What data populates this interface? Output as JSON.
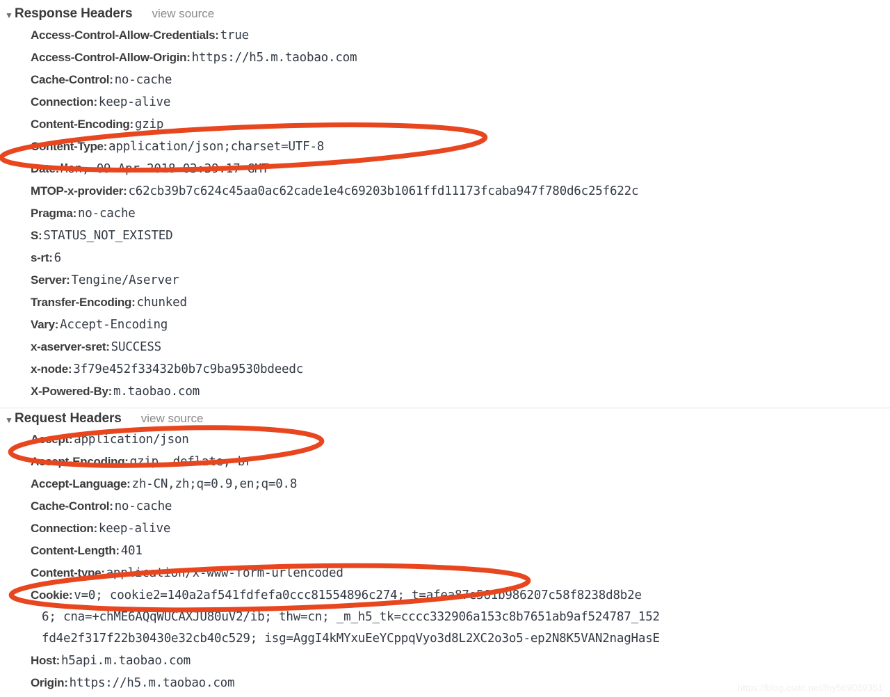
{
  "annotation_color": "#E8461E",
  "sections": [
    {
      "id": "response-headers",
      "title": "Response Headers",
      "disclosure": "▼",
      "view_source_label": "view source",
      "headers": [
        {
          "name": "Access-Control-Allow-Credentials:",
          "value": "true"
        },
        {
          "name": "Access-Control-Allow-Origin:",
          "value": "https://h5.m.taobao.com"
        },
        {
          "name": "Cache-Control:",
          "value": "no-cache"
        },
        {
          "name": "Connection:",
          "value": "keep-alive"
        },
        {
          "name": "Content-Encoding:",
          "value": "gzip"
        },
        {
          "name": "Content-Type:",
          "value": "application/json;charset=UTF-8"
        },
        {
          "name": "Date:",
          "value": "Mon, 09 Apr 2018 03:39:17 GMT"
        },
        {
          "name": "MTOP-x-provider:",
          "value": "c62cb39b7c624c45aa0ac62cade1e4c69203b1061ffd11173fcaba947f780d6c25f622c"
        },
        {
          "name": "Pragma:",
          "value": "no-cache"
        },
        {
          "name": "S:",
          "value": "STATUS_NOT_EXISTED"
        },
        {
          "name": "s-rt:",
          "value": "6"
        },
        {
          "name": "Server:",
          "value": "Tengine/Aserver"
        },
        {
          "name": "Transfer-Encoding:",
          "value": "chunked"
        },
        {
          "name": "Vary:",
          "value": "Accept-Encoding"
        },
        {
          "name": "x-aserver-sret:",
          "value": "SUCCESS"
        },
        {
          "name": "x-node:",
          "value": "3f79e452f33432b0b7c9ba9530bdeedc"
        },
        {
          "name": "X-Powered-By:",
          "value": "m.taobao.com"
        }
      ]
    },
    {
      "id": "request-headers",
      "title": "Request Headers",
      "disclosure": "▼",
      "view_source_label": "view source",
      "headers": [
        {
          "name": "Accept:",
          "value": "application/json"
        },
        {
          "name": "Accept-Encoding:",
          "value": "gzip, deflate, br"
        },
        {
          "name": "Accept-Language:",
          "value": "zh-CN,zh;q=0.9,en;q=0.8"
        },
        {
          "name": "Cache-Control:",
          "value": "no-cache"
        },
        {
          "name": "Connection:",
          "value": "keep-alive"
        },
        {
          "name": "Content-Length:",
          "value": "401"
        },
        {
          "name": "Content-type:",
          "value": "application/x-www-form-urlencoded"
        },
        {
          "name": "Cookie:",
          "value": "v=0; cookie2=140a2af541fdfefa0ccc81554896c274; t=afea87e561b986207c58f8238d8b2e",
          "continuations": [
            "6; cna=+chME6AQqWUCAXJU80uV2/ib; thw=cn; _m_h5_tk=cccc332906a153c8b7651ab9af524787_152",
            "fd4e2f317f22b30430e32cb40c529; isg=AggI4kMYxuEeYCppqVyo3d8L2XC2o3o5-ep2N8K5VAN2nagHasE"
          ]
        },
        {
          "name": "Host:",
          "value": "h5api.m.taobao.com"
        },
        {
          "name": "Origin:",
          "value": "https://h5.m.taobao.com"
        }
      ]
    }
  ],
  "watermark": "https://blog.csdn.net/fhy569039351"
}
